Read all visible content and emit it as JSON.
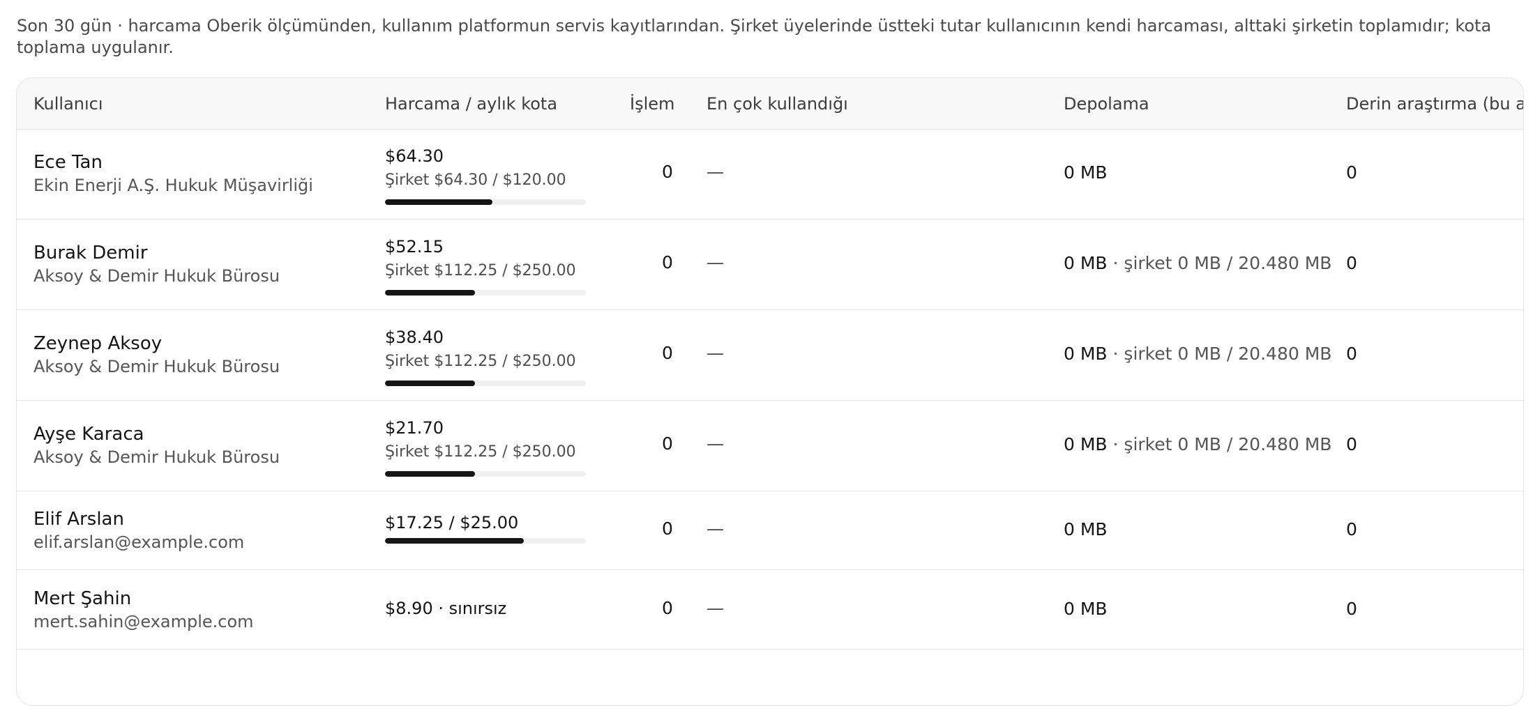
{
  "description": "Son 30 gün · harcama Oberik ölçümünden, kullanım platformun servis kayıtlarından. Şirket üyelerinde üstteki tutar kullanıcının kendi harcaması, alttaki şirketin toplamıdır; kota toplama uygulanır.",
  "columns": {
    "user": "Kullanıcı",
    "spend": "Harcama / aylık kota",
    "ops": "İşlem",
    "most_used": "En çok kullandığı",
    "storage": "Depolama",
    "deep_research": "Derin araştırma (bu ay"
  },
  "rows": [
    {
      "name": "Ece Tan",
      "sub": "Ekin Enerji A.Ş. Hukuk Müşavirliği",
      "spend": "$64.30",
      "company_spend": "Şirket $64.30 / $120.00",
      "quota_fraction": 0.536,
      "ops": "0",
      "most_used": "—",
      "storage": "0 MB",
      "storage_company": "",
      "deep_research": "0"
    },
    {
      "name": "Burak Demir",
      "sub": "Aksoy & Demir Hukuk Bürosu",
      "spend": "$52.15",
      "company_spend": "Şirket $112.25 / $250.00",
      "quota_fraction": 0.449,
      "ops": "0",
      "most_used": "—",
      "storage": "0 MB",
      "storage_company": " · şirket 0 MB / 20.480 MB",
      "deep_research": "0"
    },
    {
      "name": "Zeynep Aksoy",
      "sub": "Aksoy & Demir Hukuk Bürosu",
      "spend": "$38.40",
      "company_spend": "Şirket $112.25 / $250.00",
      "quota_fraction": 0.449,
      "ops": "0",
      "most_used": "—",
      "storage": "0 MB",
      "storage_company": " · şirket 0 MB / 20.480 MB",
      "deep_research": "0"
    },
    {
      "name": "Ayşe Karaca",
      "sub": "Aksoy & Demir Hukuk Bürosu",
      "spend": "$21.70",
      "company_spend": "Şirket $112.25 / $250.00",
      "quota_fraction": 0.449,
      "ops": "0",
      "most_used": "—",
      "storage": "0 MB",
      "storage_company": " · şirket 0 MB / 20.480 MB",
      "deep_research": "0"
    },
    {
      "name": "Elif Arslan",
      "sub": "elif.arslan@example.com",
      "spend": "$17.25 / $25.00",
      "company_spend": "",
      "quota_fraction": 0.69,
      "ops": "0",
      "most_used": "—",
      "storage": "0 MB",
      "storage_company": "",
      "deep_research": "0"
    },
    {
      "name": "Mert Şahin",
      "sub": "mert.sahin@example.com",
      "spend": "$8.90 · sınırsız",
      "company_spend": "",
      "quota_fraction": null,
      "ops": "0",
      "most_used": "—",
      "storage": "0 MB",
      "storage_company": "",
      "deep_research": "0"
    }
  ],
  "colors": {
    "bar_fill": "#151515",
    "bar_track": "#f0f0f0",
    "header_bg": "#f8f8f8"
  }
}
